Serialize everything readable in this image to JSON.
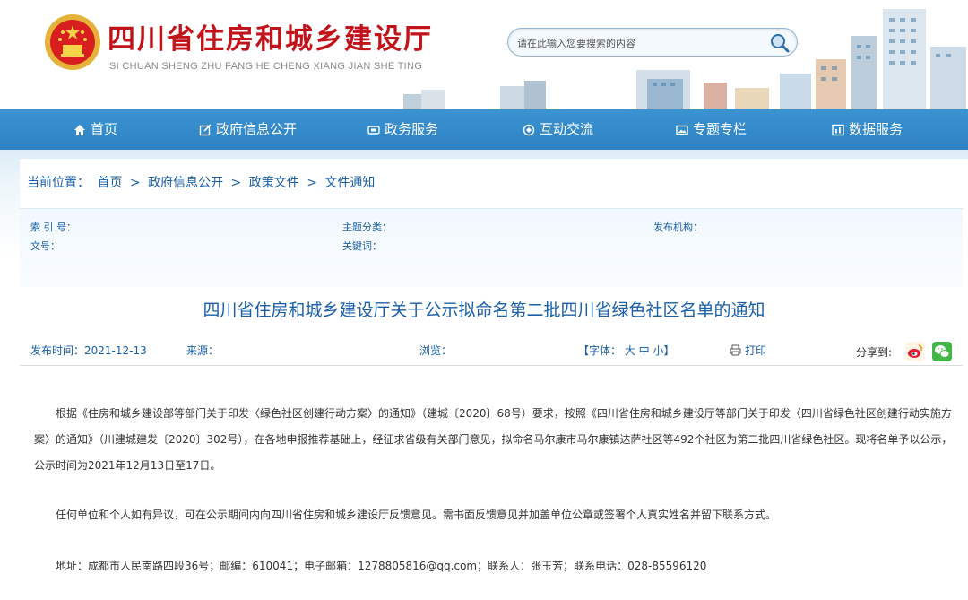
{
  "header": {
    "site_title": "四川省住房和城乡建设厅",
    "site_subtitle": "SI CHUAN SHENG ZHU FANG HE CHENG XIANG JIAN SHE TING",
    "search_placeholder": "请在此输入您要搜索的内容"
  },
  "nav": {
    "items": [
      {
        "label": "首页",
        "icon": "home-icon"
      },
      {
        "label": "政府信息公开",
        "icon": "edit-icon"
      },
      {
        "label": "政务服务",
        "icon": "service-icon"
      },
      {
        "label": "互动交流",
        "icon": "interact-icon"
      },
      {
        "label": "专题专栏",
        "icon": "image-icon"
      },
      {
        "label": "数据服务",
        "icon": "data-icon"
      }
    ]
  },
  "breadcrumb": {
    "prefix": "当前位置：",
    "items": [
      "首页",
      "政府信息公开",
      "政策文件",
      "文件通知"
    ],
    "separator": ">"
  },
  "meta": {
    "index_label": "索 引 号：",
    "topic_label": "主题分类：",
    "publisher_label": "发布机构：",
    "doc_no_label": "文号：",
    "keywords_label": "关键词："
  },
  "article": {
    "title": "四川省住房和城乡建设厅关于公示拟命名第二批四川省绿色社区名单的通知",
    "publish_time": "发布时间：2021-12-13",
    "source": "来源：",
    "views": "浏览：",
    "font_size": "【字体： 大 中 小】",
    "print": "打印",
    "share_label": "分享到:",
    "paragraphs": [
      "根据《住房和城乡建设部等部门关于印发〈绿色社区创建行动方案〉的通知》（建城〔2020〕68号）要求，按照《四川省住房和城乡建设厅等部门关于印发〈四川省绿色社区创建行动实施方案〉的通知》（川建城建发〔2020〕302号），在各地申报推荐基础上，经征求省级有关部门意见，拟命名马尔康市马尔康镇达萨社区等492个社区为第二批四川省绿色社区。现将名单予以公示，公示时间为2021年12月13日至17日。",
      "任何单位和个人如有异议，可在公示期间内向四川省住房和城乡建设厅反馈意见。需书面反馈意见并加盖单位公章或签署个人真实姓名并留下联系方式。",
      "地址：成都市人民南路四段36号；邮编：610041；电子邮箱：1278805816@qq.com；联系人：张玉芳；联系电话：028-85596120"
    ]
  },
  "colors": {
    "brand_red": "#c2121a",
    "nav_blue": "#2f82c3",
    "link_blue": "#1a5fa8"
  }
}
